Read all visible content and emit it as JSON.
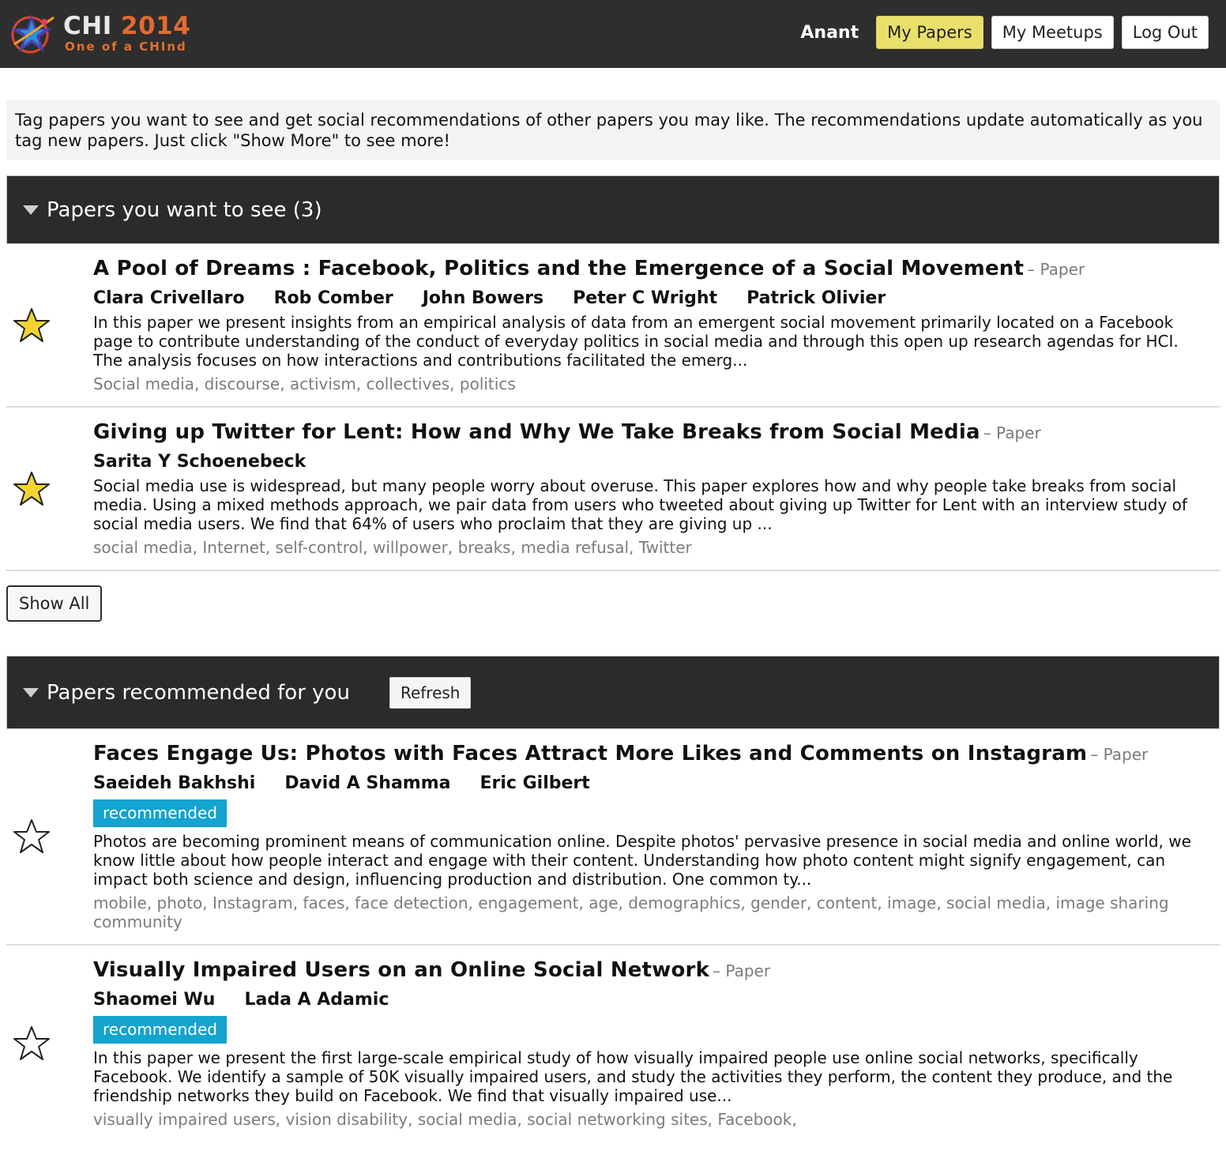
{
  "header": {
    "logo_title_a": "CHI",
    "logo_title_b": "2014",
    "logo_tagline": "One of a CHInd",
    "user_name": "Anant",
    "nav": {
      "my_papers": "My Papers",
      "my_meetups": "My Meetups",
      "log_out": "Log Out"
    },
    "colors": {
      "bar": "#2e2e2e",
      "active_button": "#e8e06a",
      "badge": "#13a4cf",
      "star_filled": "#f2d430"
    }
  },
  "intro": "Tag papers you want to see and get social recommendations of other papers you may like. The recommendations update automatically as you tag new papers. Just click \"Show More\" to see more!",
  "want_to_see": {
    "title": "Papers you want to see (3)",
    "show_all_label": "Show All",
    "papers": [
      {
        "title": "A Pool of Dreams : Facebook, Politics and the Emergence of a Social Movement",
        "type": "– Paper",
        "starred": true,
        "authors": [
          "Clara Crivellaro",
          "Rob Comber",
          "John Bowers",
          "Peter C Wright",
          "Patrick Olivier"
        ],
        "abstract": "In this paper we present insights from an empirical analysis of data from an emergent social movement primarily located on a Facebook page to contribute understanding of the conduct of everyday politics in social media and through this open up research agendas for HCI. The analysis focuses on how interactions and contributions facilitated the emerg...",
        "keywords": "Social media, discourse, activism, collectives, politics"
      },
      {
        "title": "Giving up Twitter for Lent: How and Why We Take Breaks from Social Media",
        "type": "– Paper",
        "starred": true,
        "authors": [
          "Sarita Y Schoenebeck"
        ],
        "abstract": "Social media use is widespread, but many people worry about overuse. This paper explores how and why people take breaks from social media. Using a mixed methods approach, we pair data from users who tweeted about giving up Twitter for Lent with an interview study of social media users. We find that 64% of users who proclaim that they are giving up ...",
        "keywords": "social media, Internet, self-control, willpower, breaks, media refusal, Twitter"
      }
    ]
  },
  "recommended": {
    "title": "Papers recommended for you",
    "refresh_label": "Refresh",
    "badge_label": "recommended",
    "papers": [
      {
        "title": "Faces Engage Us: Photos with Faces Attract More Likes and Comments on Instagram",
        "type": "– Paper",
        "starred": false,
        "authors": [
          "Saeideh Bakhshi",
          "David A Shamma",
          "Eric Gilbert"
        ],
        "abstract": "Photos are becoming prominent means of communication online. Despite photos' pervasive presence in social media and online world, we know little about how people interact and engage with their content. Understanding how photo content might signify engagement, can impact both science and design, influencing production and distribution. One common ty...",
        "keywords": "mobile, photo, Instagram, faces, face detection, engagement, age, demographics, gender, content, image, social media, image sharing community"
      },
      {
        "title": "Visually Impaired Users on an Online Social Network",
        "type": "– Paper",
        "starred": false,
        "authors": [
          "Shaomei Wu",
          "Lada A Adamic"
        ],
        "abstract": "In this paper we present the first large-scale empirical study of how visually impaired people use online social networks, specifically Facebook. We identify a sample of 50K visually impaired users, and study the activities they perform, the content they produce, and the friendship networks they build on Facebook. We find that visually impaired use...",
        "keywords": "visually impaired users, vision disability, social media, social networking sites, Facebook,"
      }
    ]
  }
}
